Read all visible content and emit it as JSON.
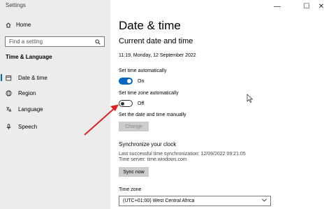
{
  "window": {
    "app_title": "Settings",
    "controls": {
      "minimize": "—",
      "maximize": "☐",
      "close": "✕"
    }
  },
  "sidebar": {
    "home_label": "Home",
    "search": {
      "placeholder": "Find a setting",
      "value": ""
    },
    "section_label": "Time & Language",
    "items": [
      {
        "label": "Date & time",
        "icon": "date-time-icon",
        "active": true
      },
      {
        "label": "Region",
        "icon": "globe-icon",
        "active": false
      },
      {
        "label": "Language",
        "icon": "language-icon",
        "active": false
      },
      {
        "label": "Speech",
        "icon": "microphone-icon",
        "active": false
      }
    ]
  },
  "main": {
    "title": "Date & time",
    "subheading": "Current date and time",
    "current_datetime": "11:19, Monday, 12 September 2022",
    "set_time_auto": {
      "label": "Set time automatically",
      "state": "On"
    },
    "set_timezone_auto": {
      "label": "Set time zone automatically",
      "state": "Off"
    },
    "manual": {
      "label": "Set the date and time manually",
      "button": "Change"
    },
    "sync": {
      "title": "Synchronize your clock",
      "last_sync": "Last successful time synchronization: 12/09/2022 09:21:05",
      "server": "Time server: time.windows.com",
      "button": "Sync now"
    },
    "timezone": {
      "label": "Time zone",
      "value": "(UTC+01:00) West Central Africa"
    }
  },
  "colors": {
    "accent": "#0067c0",
    "sidebar_bg": "#ececec",
    "annotation_arrow": "#e02020"
  }
}
